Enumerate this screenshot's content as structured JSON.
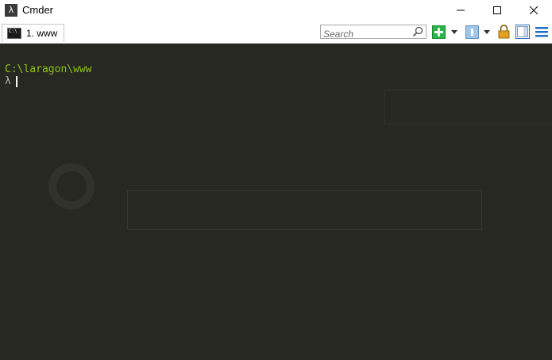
{
  "window": {
    "title": "Cmder",
    "app_icon_glyph": "λ",
    "controls": {
      "minimize": "minimize-icon",
      "maximize": "maximize-icon",
      "close": "close-icon"
    }
  },
  "tabs": [
    {
      "label": "1. www",
      "icon": "console-icon"
    }
  ],
  "toolbar": {
    "search": {
      "placeholder": "Search",
      "value": ""
    },
    "icons": [
      "search-icon",
      "new-console-icon",
      "chevron-down-icon",
      "panel-icon",
      "chevron-down-icon",
      "lock-icon",
      "layout-icon",
      "menu-icon"
    ]
  },
  "console": {
    "path": "C:\\laragon\\www",
    "prompt": "λ"
  },
  "colors": {
    "console_bg": "#272822",
    "path": "#8dc21f",
    "prompt": "#b4b4b4",
    "new_console_green": "#2cb34a",
    "lock_gold": "#e0a020",
    "accent_blue": "#1e6fc8"
  }
}
